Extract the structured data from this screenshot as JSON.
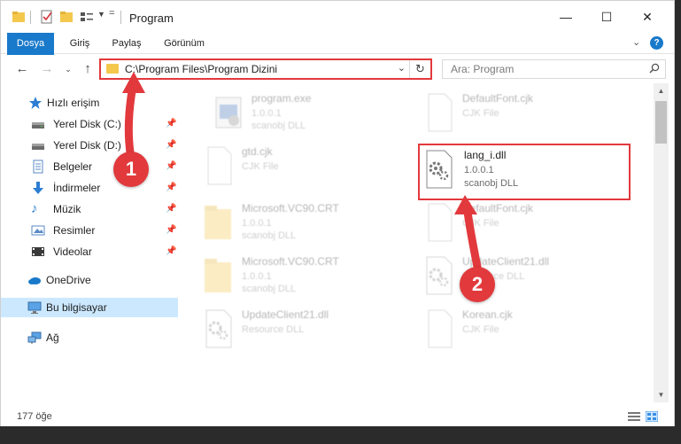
{
  "window": {
    "title": "Program",
    "controls": {
      "minimize": "—",
      "maximize": "☐",
      "close": "✕"
    }
  },
  "ribbon": {
    "tabs": [
      "Dosya",
      "Giriş",
      "Paylaş",
      "Görünüm"
    ],
    "help": "?"
  },
  "address": {
    "path": "C:\\Program Files\\Program Dizini",
    "search_placeholder": "Ara: Program"
  },
  "sidebar": {
    "items": [
      {
        "label": "Hızlı erişim",
        "icon": "star-icon",
        "pinned": false
      },
      {
        "label": "Yerel Disk (C:)",
        "icon": "drive-icon",
        "pinned": true
      },
      {
        "label": "Yerel Disk (D:)",
        "icon": "drive-icon",
        "pinned": true
      },
      {
        "label": "Belgeler",
        "icon": "documents-icon",
        "pinned": true
      },
      {
        "label": "İndirmeler",
        "icon": "download-icon",
        "pinned": true
      },
      {
        "label": "Müzik",
        "icon": "music-icon",
        "pinned": true
      },
      {
        "label": "Resimler",
        "icon": "pictures-icon",
        "pinned": true
      },
      {
        "label": "Videolar",
        "icon": "video-icon",
        "pinned": true
      },
      {
        "label": "OneDrive",
        "icon": "cloud-icon",
        "pinned": false
      },
      {
        "label": "Bu bilgisayar",
        "icon": "computer-icon",
        "pinned": false
      },
      {
        "label": "Ağ",
        "icon": "network-icon",
        "pinned": false
      }
    ]
  },
  "files": [
    {
      "name": "program.exe",
      "line2": "1.0.0.1",
      "line3": "scanobj DLL",
      "icon": "exe-icon"
    },
    {
      "name": "DefaultFont.cjk",
      "line2": "CJK File",
      "line3": "",
      "icon": "blank-file-icon"
    },
    {
      "name": "gtd.cjk",
      "line2": "CJK File",
      "line3": "",
      "icon": "blank-file-icon"
    },
    {
      "name": "lang_i.dll",
      "line2": "1.0.0.1",
      "line3": "scanobj DLL",
      "icon": "dll-gear-icon"
    },
    {
      "name": "Microsoft.VC90.CRT",
      "line2": "1.0.0.1",
      "line3": "scanobj DLL",
      "icon": "folder-icon"
    },
    {
      "name": "DefaultFont.cjk",
      "line2": "CJK File",
      "line3": "",
      "icon": "blank-file-icon"
    },
    {
      "name": "Microsoft.VC90.CRT",
      "line2": "1.0.0.1",
      "line3": "scanobj DLL",
      "icon": "folder-icon"
    },
    {
      "name": "UpdateClient21.dll",
      "line2": "Resource DLL",
      "line3": "",
      "icon": "dll-gear-icon"
    },
    {
      "name": "UpdateClient21.dll",
      "line2": "Resource DLL",
      "line3": "",
      "icon": "dll-gear-icon"
    },
    {
      "name": "Korean.cjk",
      "line2": "CJK File",
      "line3": "",
      "icon": "blank-file-icon"
    }
  ],
  "status": {
    "count": "177 öğe"
  },
  "annotations": {
    "step1": "1",
    "step2": "2",
    "color": "#e2393d"
  }
}
